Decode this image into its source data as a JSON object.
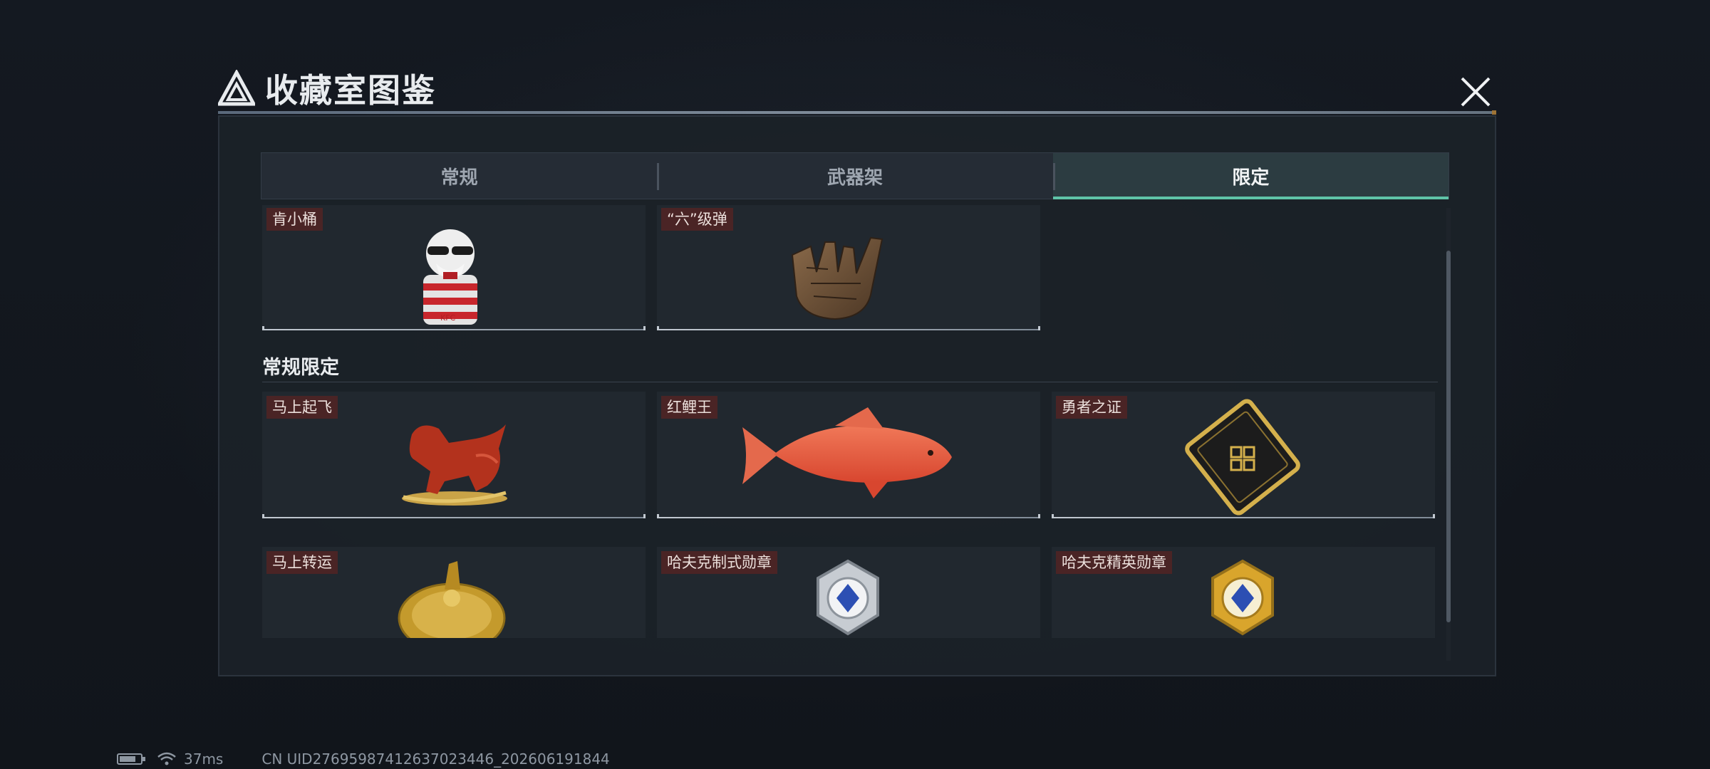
{
  "title": "收藏室图鉴",
  "tabs": [
    {
      "label": "常规",
      "active": false
    },
    {
      "label": "武器架",
      "active": false
    },
    {
      "label": "限定",
      "active": true
    }
  ],
  "top_items": [
    {
      "name": "肯小桶",
      "icon": "kfc-figurine-icon"
    },
    {
      "name": "“六”级弹",
      "icon": "metal-hand-sign-icon"
    }
  ],
  "section": {
    "title": "常规限定",
    "items": [
      {
        "name": "马上起飞",
        "icon": "rocking-horse-icon"
      },
      {
        "name": "红鲤王",
        "icon": "red-carp-icon"
      },
      {
        "name": "勇者之证",
        "icon": "gold-card-icon"
      },
      {
        "name": "马上转运",
        "icon": "gold-wheel-icon"
      },
      {
        "name": "哈夫克制式勋章",
        "icon": "silver-medal-icon"
      },
      {
        "name": "哈夫克精英勋章",
        "icon": "gold-medal-icon"
      }
    ]
  },
  "status": {
    "ping": "37ms",
    "uid": "CN UID27695987412637023446_202606191844"
  },
  "colors": {
    "accent": "#5fc4a8",
    "label_bg": "#4a2425",
    "panel": "#1b2128"
  }
}
